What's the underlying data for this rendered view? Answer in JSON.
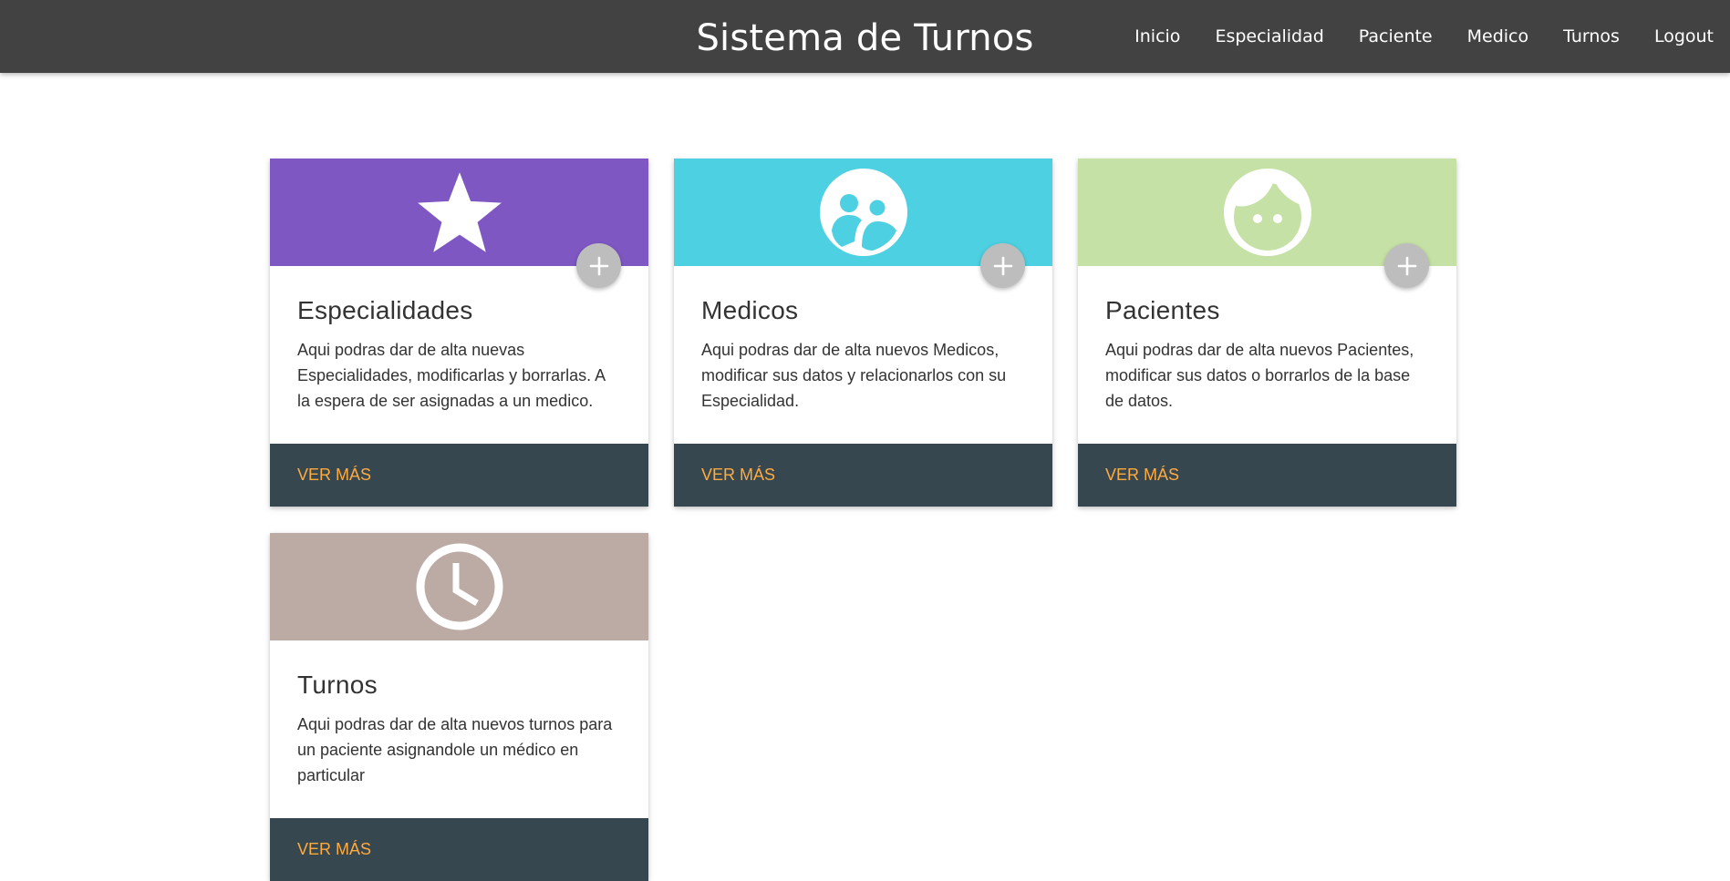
{
  "navbar": {
    "brand": "Sistema de Turnos",
    "links": [
      "Inicio",
      "Especialidad",
      "Paciente",
      "Medico",
      "Turnos",
      "Logout"
    ]
  },
  "cards": [
    {
      "icon": "star-icon",
      "color": "#7e57c2",
      "title": "Especialidades",
      "text": "Aqui podras dar de alta nuevas Especialidades, modificarlas y borrarlas. A la espera de ser asignadas a un medico.",
      "link": "VER MÁS",
      "has_add_button": true
    },
    {
      "icon": "supervisor-account-icon",
      "color": "#4dd0e1",
      "title": "Medicos",
      "text": "Aqui podras dar de alta nuevos Medicos, modificar sus datos y relacionarlos con su Especialidad.",
      "link": "VER MÁS",
      "has_add_button": true
    },
    {
      "icon": "face-icon",
      "color": "#c5e1a5",
      "title": "Pacientes",
      "text": "Aqui podras dar de alta nuevos Pacientes, modificar sus datos o borrarlos de la base de datos.",
      "link": "VER MÁS",
      "has_add_button": true
    },
    {
      "icon": "clock-icon",
      "color": "#bcaaa4",
      "title": "Turnos",
      "text": "Aqui podras dar de alta nuevos turnos para un paciente asignandole un médico en particular",
      "link": "VER MÁS",
      "has_add_button": false
    }
  ],
  "fab_icon": "add-icon"
}
